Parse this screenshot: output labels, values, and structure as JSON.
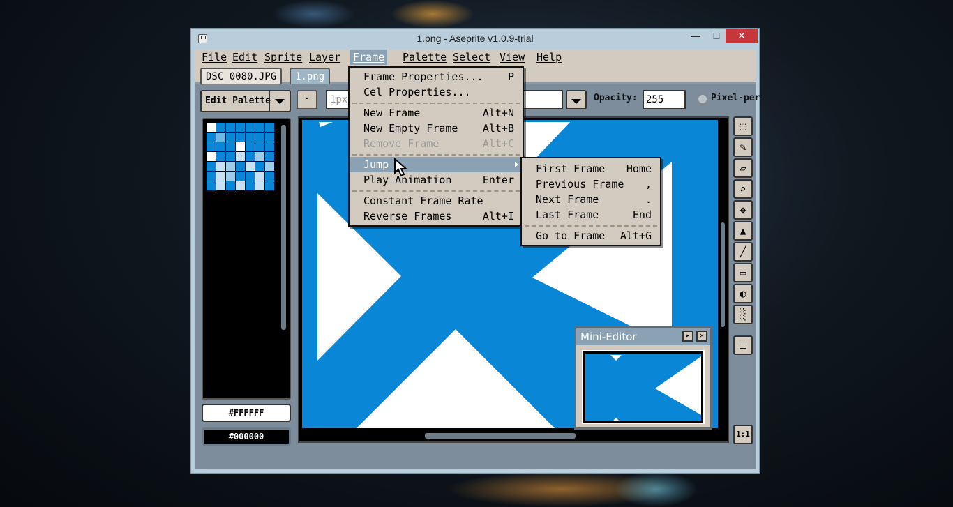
{
  "window": {
    "title": "1.png - Aseprite v1.0.9-trial",
    "min_glyph": "—",
    "max_glyph": "□",
    "close_glyph": "✕"
  },
  "menubar": [
    "File",
    "Edit",
    "Sprite",
    "Layer",
    "Frame",
    "Palette",
    "Select",
    "View",
    "Help"
  ],
  "active_menu": "Frame",
  "tabs": [
    "DSC_0080.JPG",
    "1.png"
  ],
  "active_tab": "1.png",
  "toolbar": {
    "edit_palette_label": "Edit Palette",
    "point_label": "·",
    "brush_value": "1px",
    "opacity_label": "Opacity:",
    "opacity_value": "255",
    "pixel_perfect_label": "Pixel-per"
  },
  "colors": {
    "foreground_hex": "#FFFFFF",
    "background_hex": "#000000",
    "accent": "#8aa2b3",
    "canvas_blue": "#0a86d6"
  },
  "palette_swatches": [
    "#ffffff",
    "#0a86d6",
    "#0a86d6",
    "#0a86d6",
    "#0a86d6",
    "#0a86d6",
    "#0a86d6",
    "#0a86d6",
    "#6fb7e6",
    "#0a86d6",
    "#0a86d6",
    "#0a86d6",
    "#0a86d6",
    "#0a86d6",
    "#0a86d6",
    "#0a86d6",
    "#0a86d6",
    "#ffffff",
    "#0a86d6",
    "#0a86d6",
    "#0a86d6",
    "#ffffff",
    "#0a86d6",
    "#0a86d6",
    "#c8e2f4",
    "#0a86d6",
    "#9ccde9",
    "#0a86d6",
    "#0a86d6",
    "#c8e2f4",
    "#9ccde9",
    "#0a86d6",
    "#c8e2f4",
    "#0a86d6",
    "#9ccde9",
    "#0a86d6",
    "#c8e2f4",
    "#9ccde9",
    "#0a86d6",
    "#0a86d6",
    "#c8e2f4",
    "#0a86d6",
    "#0a86d6",
    "#c8e2f4",
    "#0a86d6",
    "#c8e2f4",
    "#0a86d6",
    "#c8e2f4",
    "#0a86d6"
  ],
  "frame_menu": {
    "items": [
      {
        "label": "Frame Properties...",
        "shortcut": "P",
        "state": "normal"
      },
      {
        "label": "Cel Properties...",
        "shortcut": "",
        "state": "normal"
      },
      {
        "label": "New Frame",
        "shortcut": "Alt+N",
        "state": "normal"
      },
      {
        "label": "New Empty Frame",
        "shortcut": "Alt+B",
        "state": "normal"
      },
      {
        "label": "Remove Frame",
        "shortcut": "Alt+C",
        "state": "disabled"
      },
      {
        "label": "Jump",
        "shortcut": "",
        "state": "highlighted"
      },
      {
        "label": "Play Animation",
        "shortcut": "Enter",
        "state": "normal"
      },
      {
        "label": "Constant Frame Rate",
        "shortcut": "",
        "state": "normal"
      },
      {
        "label": "Reverse Frames",
        "shortcut": "Alt+I",
        "state": "normal"
      }
    ]
  },
  "jump_submenu": {
    "items": [
      {
        "label": "First Frame",
        "shortcut": "Home"
      },
      {
        "label": "Previous Frame",
        "shortcut": ","
      },
      {
        "label": "Next Frame",
        "shortcut": "."
      },
      {
        "label": "Last Frame",
        "shortcut": "End"
      },
      {
        "label": "Go to Frame",
        "shortcut": "Alt+G"
      }
    ]
  },
  "mini_editor": {
    "title": "Mini-Editor",
    "play_glyph": "▸",
    "close_glyph": "✕"
  },
  "tools": {
    "marquee": "⬚",
    "pencil": "✎",
    "eraser": "▱",
    "zoom": "⌕",
    "move": "✥",
    "fill": "▲",
    "line": "╱",
    "rectangle": "▭",
    "ellipse": "◐",
    "spray": "░",
    "settings": "⫫",
    "zoom_reset": "1:1"
  }
}
